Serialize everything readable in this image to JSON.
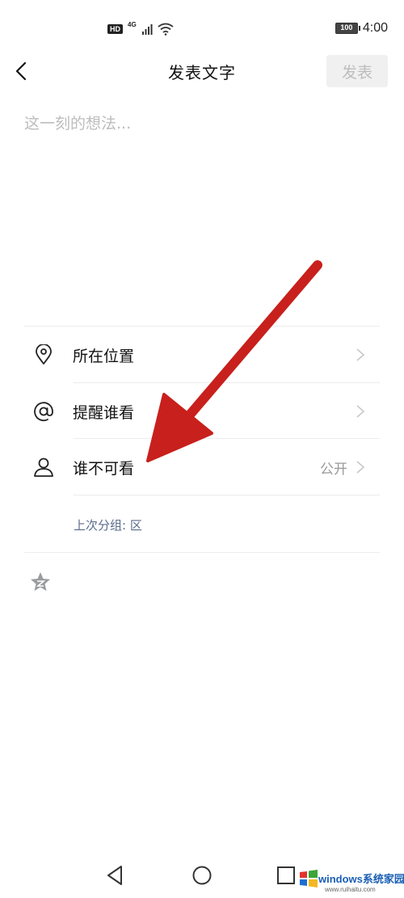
{
  "status_bar": {
    "hd": "HD",
    "network": "4G",
    "battery": "100",
    "time": "4:00"
  },
  "header": {
    "title": "发表文字",
    "publish_label": "发表"
  },
  "compose": {
    "placeholder": "这一刻的想法..."
  },
  "options": [
    {
      "label": "所在位置",
      "icon": "location-pin-icon"
    },
    {
      "label": "提醒谁看",
      "icon": "at-sign-icon"
    },
    {
      "label": "谁不可看",
      "icon": "person-icon",
      "value": "公开"
    }
  ],
  "last_group": "上次分组: 区",
  "colors": {
    "accent_red": "#c8201c",
    "link_blue": "#5b6b8c",
    "disabled": "#bdbdbd"
  },
  "watermark": {
    "text": "windows系统家园",
    "url": "www.ruihaitu.com"
  }
}
